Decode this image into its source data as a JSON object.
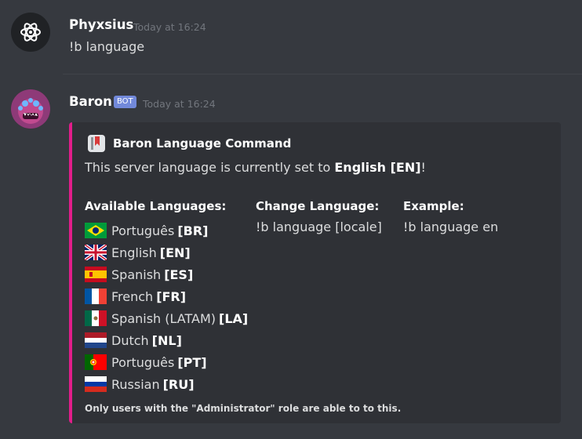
{
  "messages": [
    {
      "username": "Phyxsius",
      "timestamp": "Today at 16:24",
      "content": "!b language"
    },
    {
      "username": "Baron",
      "badge": "BOT",
      "timestamp": "Today at 16:24",
      "embed": {
        "author": "Baron Language Command",
        "description_prefix": "This server language is currently set to ",
        "description_bold": "English [EN]",
        "description_suffix": "!",
        "fields": [
          {
            "name": "Available Languages:"
          },
          {
            "name": "Change Language:",
            "value": "!b language [locale]"
          },
          {
            "name": "Example:",
            "value": "!b language en"
          }
        ],
        "languages": [
          {
            "name": "Português",
            "code": "[BR]",
            "flag": "brazil-flag-icon"
          },
          {
            "name": "English",
            "code": "[EN]",
            "flag": "uk-flag-icon"
          },
          {
            "name": "Spanish",
            "code": "[ES]",
            "flag": "spain-flag-icon"
          },
          {
            "name": "French",
            "code": "[FR]",
            "flag": "france-flag-icon"
          },
          {
            "name": "Spanish (LATAM)",
            "code": "[LA]",
            "flag": "mexico-flag-icon"
          },
          {
            "name": "Dutch",
            "code": "[NL]",
            "flag": "netherlands-flag-icon"
          },
          {
            "name": "Português",
            "code": "[PT]",
            "flag": "portugal-flag-icon"
          },
          {
            "name": "Russian",
            "code": "[RU]",
            "flag": "russia-flag-icon"
          }
        ],
        "footer": "Only users with the \"Administrator\" role are able to to this.",
        "accent_color": "#e11d8a"
      }
    }
  ],
  "colors": {
    "background": "#36393f",
    "embed": "#2f3136",
    "bot_badge": "#7289da"
  }
}
